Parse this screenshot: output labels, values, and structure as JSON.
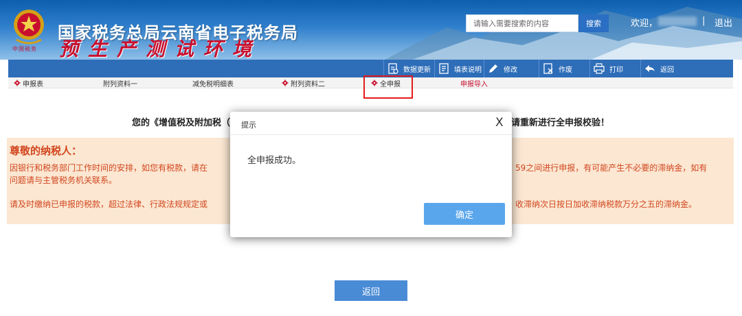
{
  "header": {
    "site_title": "国家税务总局云南省电子税务局",
    "env_title": "预生产测试环境",
    "emblem_caption": "中国税务",
    "search": {
      "placeholder": "请输入需要搜索的内容",
      "button": "搜索"
    },
    "welcome": "欢迎，",
    "separator": "|",
    "logout": "退出"
  },
  "toolbar": {
    "items": [
      {
        "label": "数据更新",
        "icon": "data-update-icon"
      },
      {
        "label": "填表说明",
        "icon": "fill-guide-icon"
      },
      {
        "label": "修改",
        "icon": "edit-icon"
      },
      {
        "label": "作废",
        "icon": "void-icon"
      },
      {
        "label": "打印",
        "icon": "print-icon"
      },
      {
        "label": "返回",
        "icon": "back-arrow-icon"
      }
    ]
  },
  "tabs": [
    {
      "label": "申报表",
      "gear": true,
      "red": false
    },
    {
      "label": "附列资料一",
      "gear": false,
      "red": false
    },
    {
      "label": "减免税明细表",
      "gear": false,
      "red": false
    },
    {
      "label": "附列资料二",
      "gear": true,
      "red": false
    },
    {
      "label": "全申报",
      "gear": true,
      "red": false
    },
    {
      "label": "申报导入",
      "gear": false,
      "red": true
    }
  ],
  "main": {
    "result_left": "您的《增值税及附加税（",
    "result_right": "请重新进行全申报校验！",
    "notice_title": "尊敬的纳税人：",
    "notice_line1_left": "因银行和税务部门工作时间的安排，如您有税款，请在",
    "notice_line1_right": "59之间进行申报，有可能产生不必要的滞纳金，如有",
    "notice_line2": "问题请与主管税务机关联系。",
    "notice_line3_left": "请及时缴纳已申报的税款，超过法律、行政法规规定或",
    "notice_line3_right": "收滞纳次日按日加收滞纳税款万分之五的滞纳金。",
    "return_button": "返回"
  },
  "modal": {
    "title": "提示",
    "close": "X",
    "message": "全申报成功。",
    "ok_button": "确定"
  },
  "colors": {
    "banner": "#1c6fc0",
    "toolbar": "#2e6db8",
    "notice_bg": "#fbe7d2",
    "notice_text": "#d2461e",
    "primary_button": "#5aa6ec",
    "highlight": "#e31b1b"
  }
}
